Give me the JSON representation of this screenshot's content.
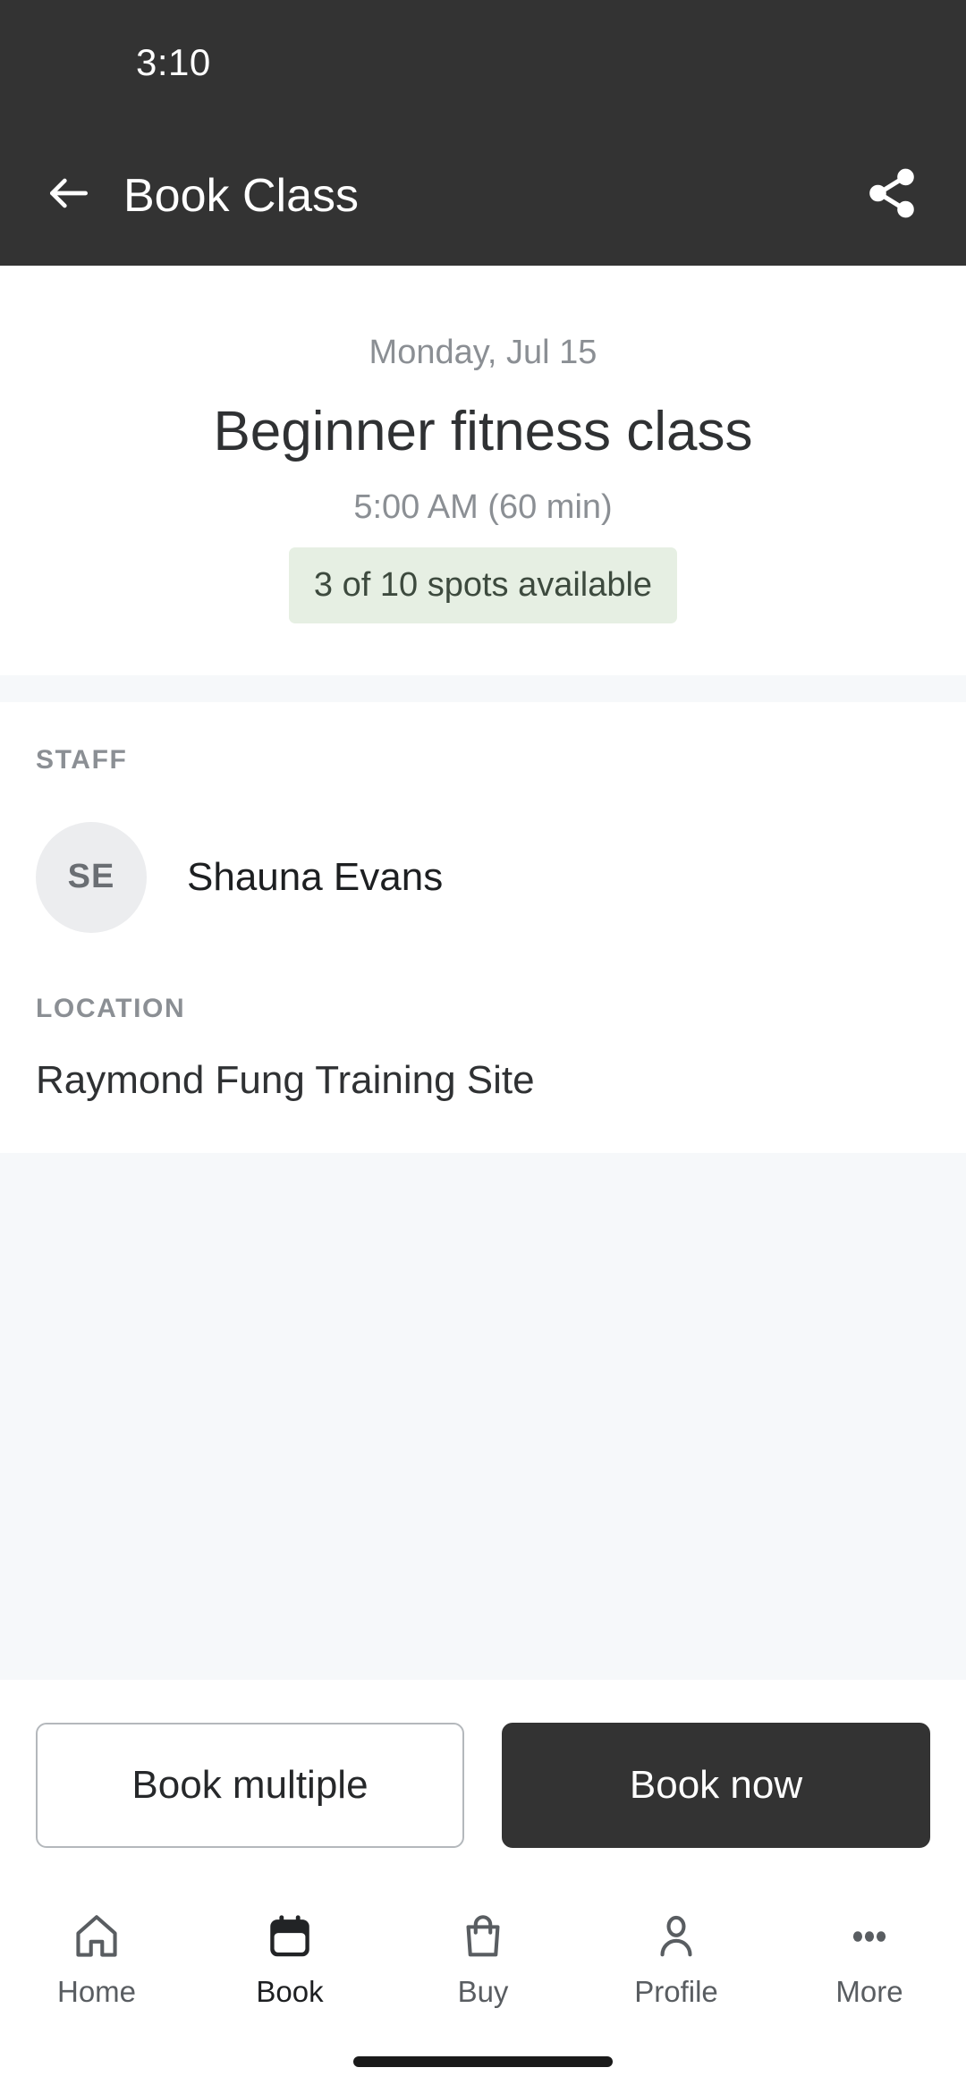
{
  "status_bar": {
    "time": "3:10"
  },
  "app_bar": {
    "title": "Book Class",
    "back_icon": "arrow-left-icon",
    "share_icon": "share-icon"
  },
  "hero": {
    "date": "Monday, Jul 15",
    "title": "Beginner fitness class",
    "time": "5:00 AM (60 min)",
    "spots_badge": "3 of 10 spots available",
    "spots_badge_bg": "#e6efe3",
    "spots_badge_color": "#3d4a3e"
  },
  "staff": {
    "label": "STAFF",
    "initials": "SE",
    "name": "Shauna Evans"
  },
  "location": {
    "label": "LOCATION",
    "value": "Raymond Fung Training Site"
  },
  "actions": {
    "secondary_label": "Book multiple",
    "primary_label": "Book now",
    "primary_bg": "#333333"
  },
  "bottom_nav": {
    "items": [
      {
        "label": "Home",
        "icon": "home-icon",
        "active": false
      },
      {
        "label": "Book",
        "icon": "calendar-icon",
        "active": true
      },
      {
        "label": "Buy",
        "icon": "bag-icon",
        "active": false
      },
      {
        "label": "Profile",
        "icon": "person-icon",
        "active": false
      },
      {
        "label": "More",
        "icon": "ellipsis-icon",
        "active": false
      }
    ]
  },
  "theme": {
    "header_bg": "#333333",
    "page_bg": "#ffffff",
    "band_bg": "#f6f8fa"
  }
}
